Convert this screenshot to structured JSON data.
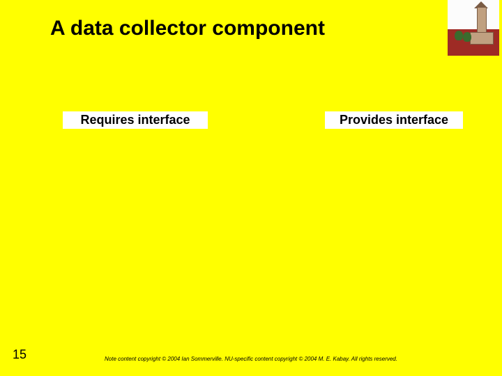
{
  "title": "A data collector component",
  "labels": {
    "requires": "Requires interface",
    "provides": "Provides interface"
  },
  "page_number": "15",
  "footer": "Note content copyright © 2004 Ian Sommerville.  NU-specific content copyright © 2004 M. E. Kabay.  All rights reserved."
}
